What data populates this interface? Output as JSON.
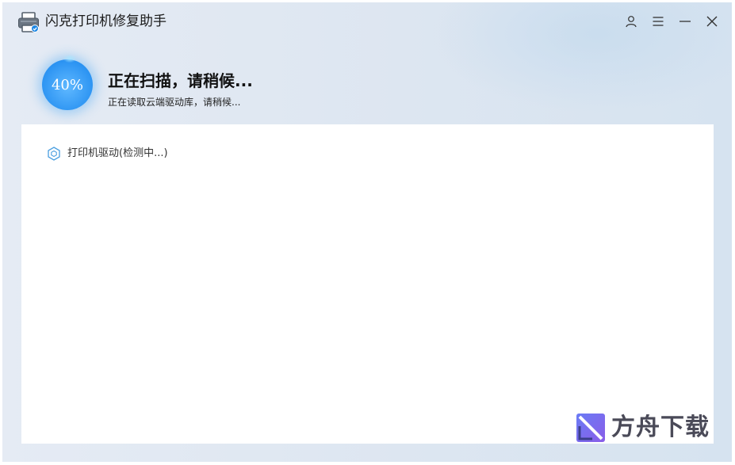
{
  "app": {
    "title": "闪克打印机修复助手",
    "icon": "printer-icon"
  },
  "titlebar": {
    "buttons": [
      "user-icon",
      "menu-icon",
      "minimize-icon",
      "close-icon"
    ]
  },
  "scan": {
    "progress_text": "40%",
    "progress_value": 40,
    "title": "正在扫描，请稍候...",
    "subtitle": "正在读取云端驱动库，请稍候..."
  },
  "items": [
    {
      "icon": "hexagon-icon",
      "label": "打印机驱动(检测中...)"
    }
  ],
  "watermark": {
    "text": "方舟下载"
  },
  "colors": {
    "accent": "#2b93f2",
    "background": "#dde6f1",
    "panel": "#ffffff"
  }
}
